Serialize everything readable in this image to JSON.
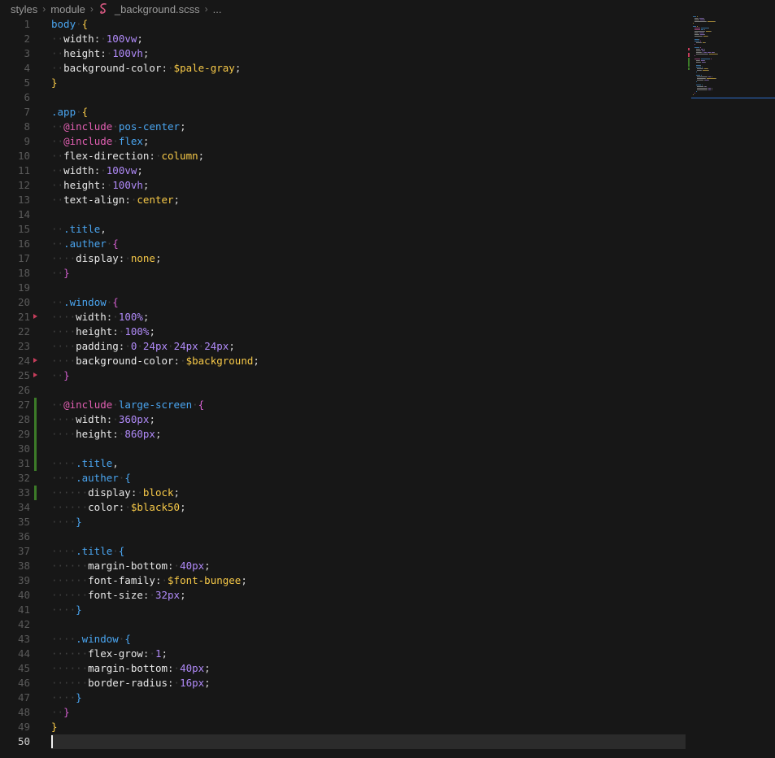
{
  "breadcrumb": {
    "items": [
      "styles",
      "module"
    ],
    "file": "_background.scss",
    "ellipsis": "..."
  },
  "editor": {
    "current_line": 50,
    "lines": [
      {
        "n": "1",
        "tokens": [
          [
            "sel",
            "body"
          ],
          [
            "dot",
            "·"
          ],
          [
            "b1",
            "{"
          ]
        ]
      },
      {
        "n": "2",
        "tokens": [
          [
            "dot",
            "··"
          ],
          [
            "prop",
            "width"
          ],
          [
            "punc",
            ":"
          ],
          [
            "dot",
            "·"
          ],
          [
            "num",
            "100vw"
          ],
          [
            "punc",
            ";"
          ]
        ]
      },
      {
        "n": "3",
        "tokens": [
          [
            "dot",
            "··"
          ],
          [
            "prop",
            "height"
          ],
          [
            "punc",
            ":"
          ],
          [
            "dot",
            "·"
          ],
          [
            "num",
            "100vh"
          ],
          [
            "punc",
            ";"
          ]
        ]
      },
      {
        "n": "4",
        "tokens": [
          [
            "dot",
            "··"
          ],
          [
            "prop",
            "background-color"
          ],
          [
            "punc",
            ":"
          ],
          [
            "dot",
            "·"
          ],
          [
            "var",
            "$pale-gray"
          ],
          [
            "punc",
            ";"
          ]
        ]
      },
      {
        "n": "5",
        "tokens": [
          [
            "b1",
            "}"
          ]
        ]
      },
      {
        "n": "6",
        "tokens": []
      },
      {
        "n": "7",
        "tokens": [
          [
            "sel",
            ".app"
          ],
          [
            "dot",
            "·"
          ],
          [
            "b1",
            "{"
          ]
        ]
      },
      {
        "n": "8",
        "tokens": [
          [
            "dot",
            "··"
          ],
          [
            "at",
            "@include"
          ],
          [
            "dot",
            "·"
          ],
          [
            "mix",
            "pos-center"
          ],
          [
            "punc",
            ";"
          ]
        ]
      },
      {
        "n": "9",
        "tokens": [
          [
            "dot",
            "··"
          ],
          [
            "at",
            "@include"
          ],
          [
            "dot",
            "·"
          ],
          [
            "mix",
            "flex"
          ],
          [
            "punc",
            ";"
          ]
        ]
      },
      {
        "n": "10",
        "tokens": [
          [
            "dot",
            "··"
          ],
          [
            "prop",
            "flex-direction"
          ],
          [
            "punc",
            ":"
          ],
          [
            "dot",
            "·"
          ],
          [
            "val",
            "column"
          ],
          [
            "punc",
            ";"
          ]
        ]
      },
      {
        "n": "11",
        "tokens": [
          [
            "dot",
            "··"
          ],
          [
            "prop",
            "width"
          ],
          [
            "punc",
            ":"
          ],
          [
            "dot",
            "·"
          ],
          [
            "num",
            "100vw"
          ],
          [
            "punc",
            ";"
          ]
        ]
      },
      {
        "n": "12",
        "tokens": [
          [
            "dot",
            "··"
          ],
          [
            "prop",
            "height"
          ],
          [
            "punc",
            ":"
          ],
          [
            "dot",
            "·"
          ],
          [
            "num",
            "100vh"
          ],
          [
            "punc",
            ";"
          ]
        ]
      },
      {
        "n": "13",
        "tokens": [
          [
            "dot",
            "··"
          ],
          [
            "prop",
            "text-align"
          ],
          [
            "punc",
            ":"
          ],
          [
            "dot",
            "·"
          ],
          [
            "val",
            "center"
          ],
          [
            "punc",
            ";"
          ]
        ]
      },
      {
        "n": "14",
        "tokens": []
      },
      {
        "n": "15",
        "tokens": [
          [
            "dot",
            "··"
          ],
          [
            "sel",
            ".title"
          ],
          [
            "punc",
            ","
          ]
        ]
      },
      {
        "n": "16",
        "tokens": [
          [
            "dot",
            "··"
          ],
          [
            "sel",
            ".auther"
          ],
          [
            "dot",
            "·"
          ],
          [
            "b2",
            "{"
          ]
        ]
      },
      {
        "n": "17",
        "tokens": [
          [
            "dot",
            "····"
          ],
          [
            "prop",
            "display"
          ],
          [
            "punc",
            ":"
          ],
          [
            "dot",
            "·"
          ],
          [
            "val",
            "none"
          ],
          [
            "punc",
            ";"
          ]
        ]
      },
      {
        "n": "18",
        "tokens": [
          [
            "dot",
            "··"
          ],
          [
            "b2",
            "}"
          ]
        ]
      },
      {
        "n": "19",
        "tokens": []
      },
      {
        "n": "20",
        "tokens": [
          [
            "dot",
            "··"
          ],
          [
            "sel",
            ".window"
          ],
          [
            "dot",
            "·"
          ],
          [
            "b2",
            "{"
          ]
        ],
        "gutter": ""
      },
      {
        "n": "21",
        "tokens": [
          [
            "dot",
            "····"
          ],
          [
            "prop",
            "width"
          ],
          [
            "punc",
            ":"
          ],
          [
            "dot",
            "·"
          ],
          [
            "num",
            "100%"
          ],
          [
            "punc",
            ";"
          ]
        ],
        "gutter": "deleted"
      },
      {
        "n": "22",
        "tokens": [
          [
            "dot",
            "····"
          ],
          [
            "prop",
            "height"
          ],
          [
            "punc",
            ":"
          ],
          [
            "dot",
            "·"
          ],
          [
            "num",
            "100%"
          ],
          [
            "punc",
            ";"
          ]
        ]
      },
      {
        "n": "23",
        "tokens": [
          [
            "dot",
            "····"
          ],
          [
            "prop",
            "padding"
          ],
          [
            "punc",
            ":"
          ],
          [
            "dot",
            "·"
          ],
          [
            "num",
            "0"
          ],
          [
            "dot",
            "·"
          ],
          [
            "num",
            "24px"
          ],
          [
            "dot",
            "·"
          ],
          [
            "num",
            "24px"
          ],
          [
            "dot",
            "·"
          ],
          [
            "num",
            "24px"
          ],
          [
            "punc",
            ";"
          ]
        ]
      },
      {
        "n": "24",
        "tokens": [
          [
            "dot",
            "····"
          ],
          [
            "prop",
            "background-color"
          ],
          [
            "punc",
            ":"
          ],
          [
            "dot",
            "·"
          ],
          [
            "var",
            "$background"
          ],
          [
            "punc",
            ";"
          ]
        ],
        "gutter": "deleted"
      },
      {
        "n": "25",
        "tokens": [
          [
            "dot",
            "··"
          ],
          [
            "b2",
            "}"
          ]
        ],
        "gutter": "deleted"
      },
      {
        "n": "26",
        "tokens": []
      },
      {
        "n": "27",
        "tokens": [
          [
            "dot",
            "··"
          ],
          [
            "at",
            "@include"
          ],
          [
            "dot",
            "·"
          ],
          [
            "mix",
            "large-screen"
          ],
          [
            "dot",
            "·"
          ],
          [
            "b2",
            "{"
          ]
        ],
        "gutter": "added"
      },
      {
        "n": "28",
        "tokens": [
          [
            "dot",
            "····"
          ],
          [
            "prop",
            "width"
          ],
          [
            "punc",
            ":"
          ],
          [
            "dot",
            "·"
          ],
          [
            "num",
            "360px"
          ],
          [
            "punc",
            ";"
          ]
        ],
        "gutter": "added"
      },
      {
        "n": "29",
        "tokens": [
          [
            "dot",
            "····"
          ],
          [
            "prop",
            "height"
          ],
          [
            "punc",
            ":"
          ],
          [
            "dot",
            "·"
          ],
          [
            "num",
            "860px"
          ],
          [
            "punc",
            ";"
          ]
        ],
        "gutter": "added"
      },
      {
        "n": "30",
        "tokens": [],
        "gutter": "added"
      },
      {
        "n": "31",
        "tokens": [
          [
            "dot",
            "····"
          ],
          [
            "sel",
            ".title"
          ],
          [
            "punc",
            ","
          ]
        ],
        "gutter": "added"
      },
      {
        "n": "32",
        "tokens": [
          [
            "dot",
            "····"
          ],
          [
            "sel",
            ".auther"
          ],
          [
            "dot",
            "·"
          ],
          [
            "b3",
            "{"
          ]
        ]
      },
      {
        "n": "33",
        "tokens": [
          [
            "dot",
            "······"
          ],
          [
            "prop",
            "display"
          ],
          [
            "punc",
            ":"
          ],
          [
            "dot",
            "·"
          ],
          [
            "val",
            "block"
          ],
          [
            "punc",
            ";"
          ]
        ],
        "gutter": "added"
      },
      {
        "n": "34",
        "tokens": [
          [
            "dot",
            "······"
          ],
          [
            "prop",
            "color"
          ],
          [
            "punc",
            ":"
          ],
          [
            "dot",
            "·"
          ],
          [
            "var",
            "$black50"
          ],
          [
            "punc",
            ";"
          ]
        ]
      },
      {
        "n": "35",
        "tokens": [
          [
            "dot",
            "····"
          ],
          [
            "b3",
            "}"
          ]
        ]
      },
      {
        "n": "36",
        "tokens": []
      },
      {
        "n": "37",
        "tokens": [
          [
            "dot",
            "····"
          ],
          [
            "sel",
            ".title"
          ],
          [
            "dot",
            "·"
          ],
          [
            "b3",
            "{"
          ]
        ]
      },
      {
        "n": "38",
        "tokens": [
          [
            "dot",
            "······"
          ],
          [
            "prop",
            "margin-bottom"
          ],
          [
            "punc",
            ":"
          ],
          [
            "dot",
            "·"
          ],
          [
            "num",
            "40px"
          ],
          [
            "punc",
            ";"
          ]
        ]
      },
      {
        "n": "39",
        "tokens": [
          [
            "dot",
            "······"
          ],
          [
            "prop",
            "font-family"
          ],
          [
            "punc",
            ":"
          ],
          [
            "dot",
            "·"
          ],
          [
            "var",
            "$font-bungee"
          ],
          [
            "punc",
            ";"
          ]
        ]
      },
      {
        "n": "40",
        "tokens": [
          [
            "dot",
            "······"
          ],
          [
            "prop",
            "font-size"
          ],
          [
            "punc",
            ":"
          ],
          [
            "dot",
            "·"
          ],
          [
            "num",
            "32px"
          ],
          [
            "punc",
            ";"
          ]
        ]
      },
      {
        "n": "41",
        "tokens": [
          [
            "dot",
            "····"
          ],
          [
            "b3",
            "}"
          ]
        ]
      },
      {
        "n": "42",
        "tokens": []
      },
      {
        "n": "43",
        "tokens": [
          [
            "dot",
            "····"
          ],
          [
            "sel",
            ".window"
          ],
          [
            "dot",
            "·"
          ],
          [
            "b3",
            "{"
          ]
        ]
      },
      {
        "n": "44",
        "tokens": [
          [
            "dot",
            "······"
          ],
          [
            "prop",
            "flex-grow"
          ],
          [
            "punc",
            ":"
          ],
          [
            "dot",
            "·"
          ],
          [
            "num",
            "1"
          ],
          [
            "punc",
            ";"
          ]
        ]
      },
      {
        "n": "45",
        "tokens": [
          [
            "dot",
            "······"
          ],
          [
            "prop",
            "margin-bottom"
          ],
          [
            "punc",
            ":"
          ],
          [
            "dot",
            "·"
          ],
          [
            "num",
            "40px"
          ],
          [
            "punc",
            ";"
          ]
        ]
      },
      {
        "n": "46",
        "tokens": [
          [
            "dot",
            "······"
          ],
          [
            "prop",
            "border-radius"
          ],
          [
            "punc",
            ":"
          ],
          [
            "dot",
            "·"
          ],
          [
            "num",
            "16px"
          ],
          [
            "punc",
            ";"
          ]
        ]
      },
      {
        "n": "47",
        "tokens": [
          [
            "dot",
            "····"
          ],
          [
            "b3",
            "}"
          ]
        ]
      },
      {
        "n": "48",
        "tokens": [
          [
            "dot",
            "··"
          ],
          [
            "b2",
            "}"
          ]
        ]
      },
      {
        "n": "49",
        "tokens": [
          [
            "b1",
            "}"
          ]
        ]
      },
      {
        "n": "50",
        "tokens": []
      }
    ]
  },
  "colors": {
    "background": "#171717",
    "selector": "#4aa5f0",
    "number": "#b08af8",
    "value": "#f7c948",
    "at_rule": "#e05fb1",
    "added_gutter": "#3c7b28",
    "deleted_gutter": "#c53d5b"
  },
  "icons": {
    "file": "sass-icon",
    "separator": "chevron-right-icon"
  }
}
